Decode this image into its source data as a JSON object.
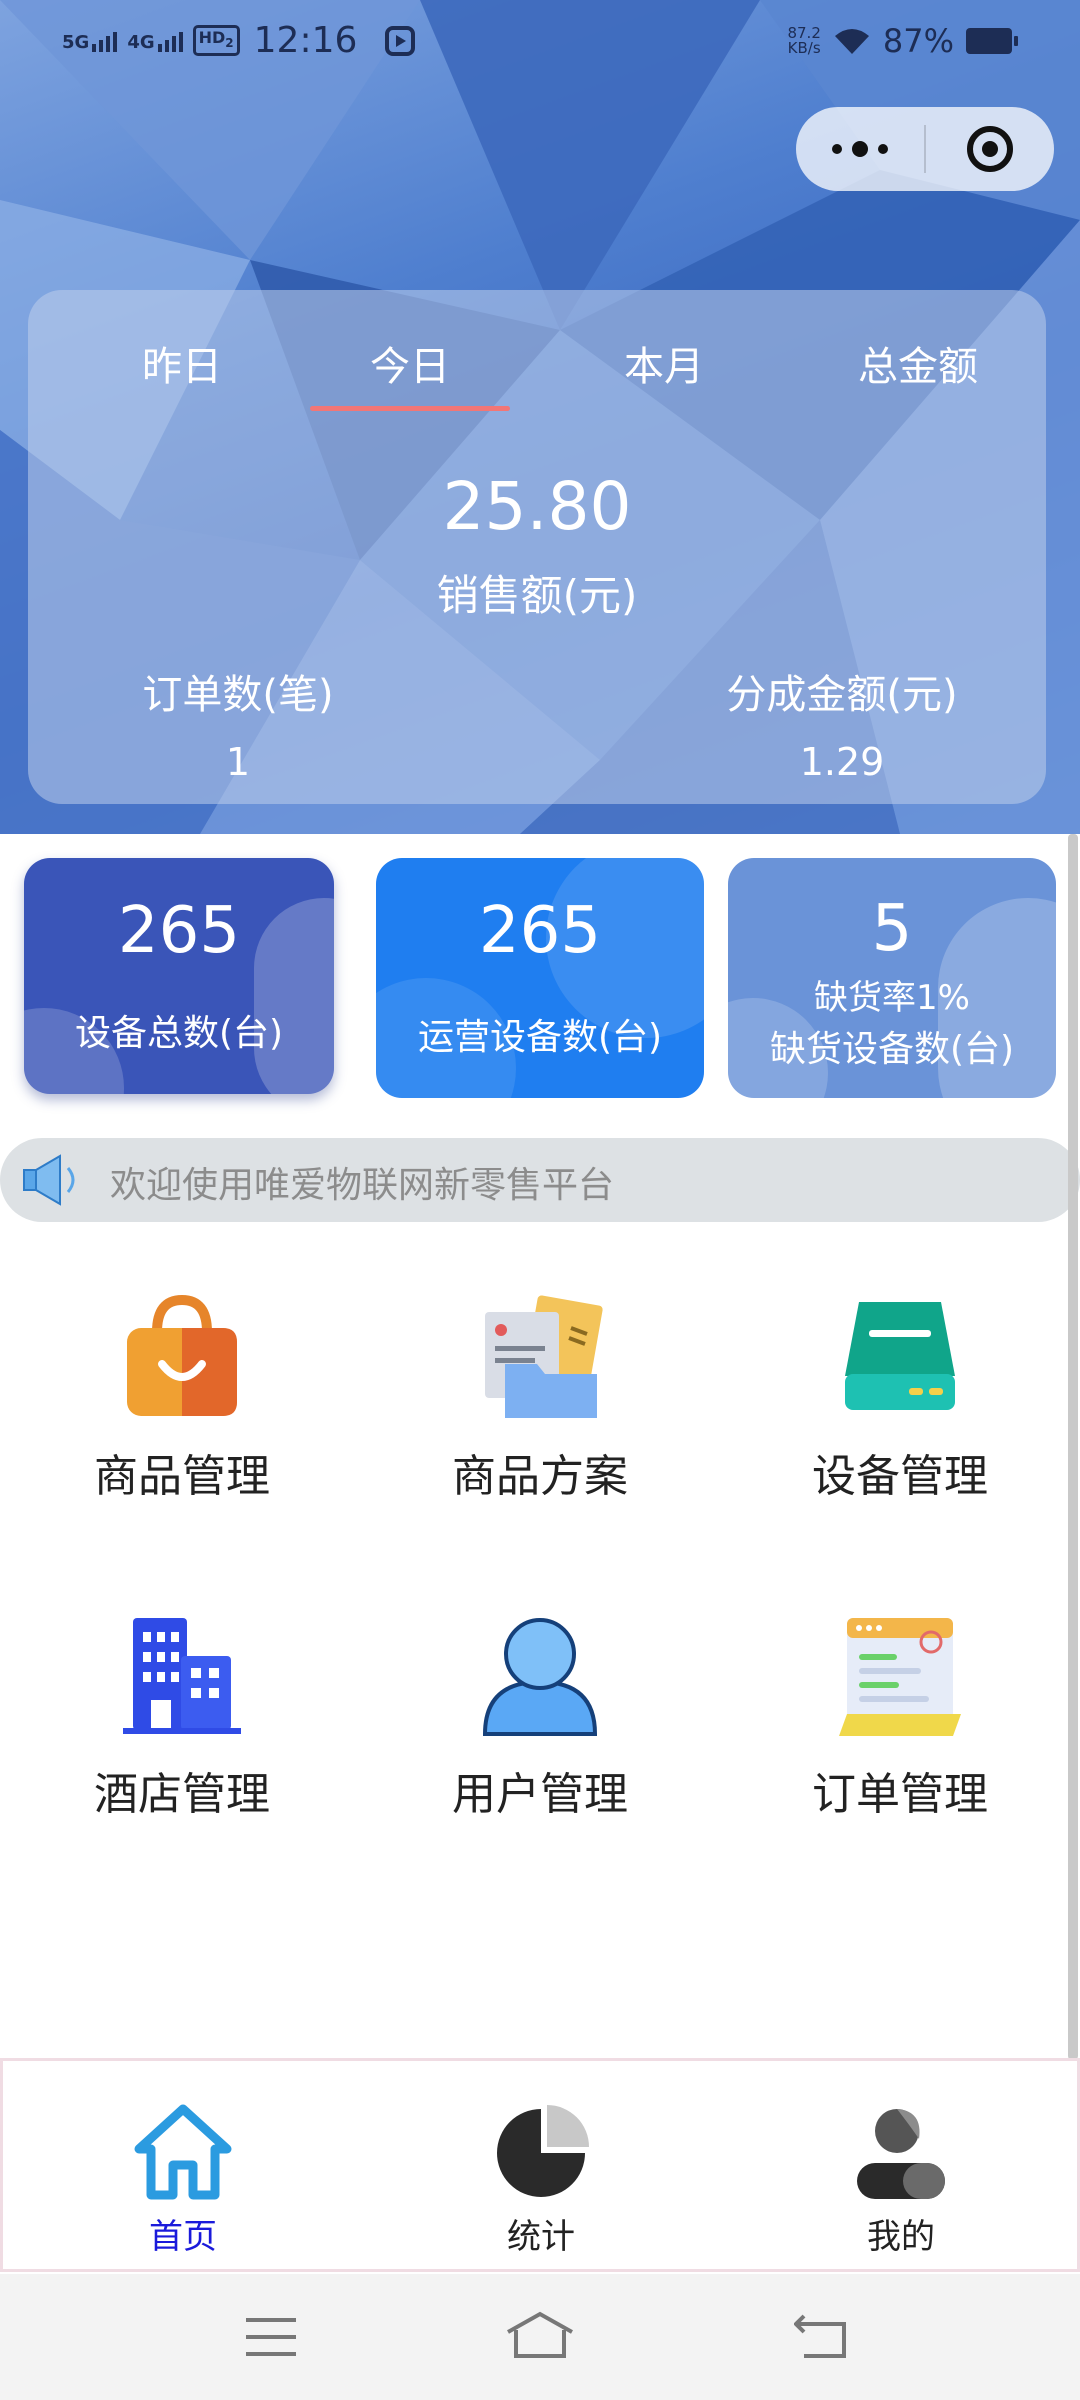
{
  "status_bar": {
    "net1": "5G",
    "net2": "4G",
    "hd": "HD",
    "hd_sub": "2",
    "time": "12:16",
    "speed_value": "87.2",
    "speed_unit": "KB/s",
    "battery": "87%"
  },
  "stats": {
    "tabs": [
      "昨日",
      "今日",
      "本月",
      "总金额"
    ],
    "active_tab": "今日",
    "sales_amount": "25.80",
    "sales_label": "销售额(元)",
    "orders_label": "订单数(笔)",
    "orders_value": "1",
    "share_label": "分成金额(元)",
    "share_value": "1.29"
  },
  "devices": {
    "total": {
      "value": "265",
      "label": "设备总数(台)",
      "color": "#3a55b8"
    },
    "operating": {
      "value": "265",
      "label": "运营设备数(台)",
      "color": "#1f7ef0"
    },
    "shortage": {
      "value": "5",
      "rate": "缺货率1%",
      "label": "缺货设备数(台)",
      "color": "#6a93d8"
    }
  },
  "notice": {
    "text": "欢迎使用唯爱物联网新零售平台"
  },
  "functions": [
    {
      "label": "商品管理",
      "icon": "shopping-bag-icon"
    },
    {
      "label": "商品方案",
      "icon": "folder-documents-icon"
    },
    {
      "label": "设备管理",
      "icon": "device-drive-icon"
    },
    {
      "label": "酒店管理",
      "icon": "hotel-building-icon"
    },
    {
      "label": "用户管理",
      "icon": "user-icon"
    },
    {
      "label": "订单管理",
      "icon": "order-list-icon"
    }
  ],
  "tabbar": {
    "home": "首页",
    "stats": "统计",
    "mine": "我的",
    "active": "首页",
    "active_color": "#1a1adb",
    "home_icon_color": "#2b9be0"
  }
}
